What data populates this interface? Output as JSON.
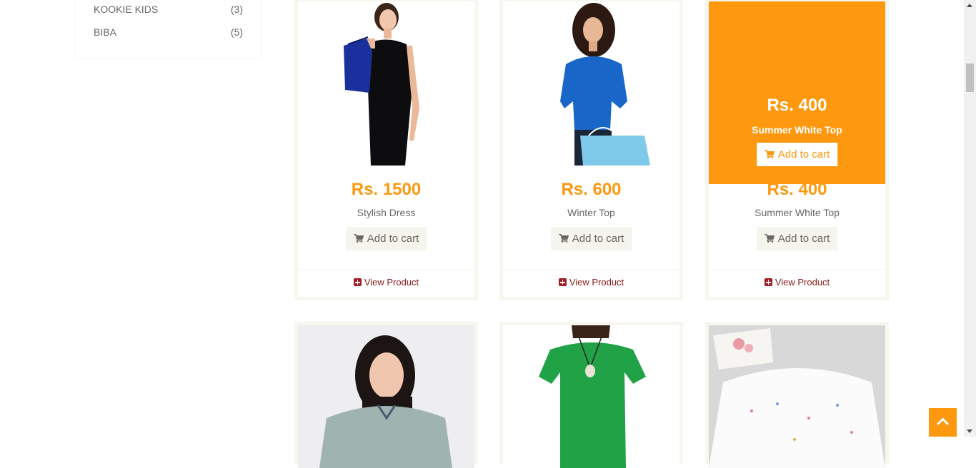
{
  "brands": [
    {
      "name": "KOOKIE KIDS",
      "count": "(3)"
    },
    {
      "name": "BIBA",
      "count": "(5)"
    }
  ],
  "products": [
    {
      "price": "Rs. 1500",
      "name": "Stylish Dress",
      "cart_label": "Add to cart",
      "view_label": "View Product",
      "image": "woman-black-dress-shopping-bag"
    },
    {
      "price": "Rs. 600",
      "name": "Winter Top",
      "cart_label": "Add to cart",
      "view_label": "View Product",
      "image": "woman-blue-top-shopping-bag"
    },
    {
      "price": "Rs. 400",
      "name": "Summer White Top",
      "cart_label": "Add to cart",
      "view_label": "View Product",
      "image": "summer-white-top",
      "overlay": {
        "price": "Rs. 400",
        "name": "Summer White Top",
        "cart_label": "Add to cart"
      }
    }
  ],
  "next_row_images": [
    "woman-floral-blouse",
    "woman-green-top-necklace",
    "white-printed-kids-top"
  ],
  "colors": {
    "accent": "#FE980F",
    "view_link": "#8a1a1a",
    "button_bg": "#F5F5ED"
  }
}
